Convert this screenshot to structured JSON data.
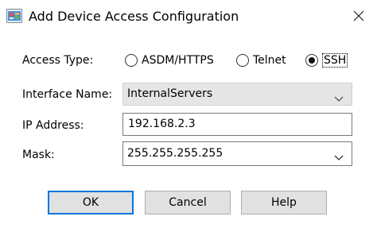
{
  "window": {
    "title": "Add Device Access Configuration",
    "app_icon": "asdm-app-icon",
    "close_icon": "close-icon"
  },
  "form": {
    "access_type": {
      "label": "Access Type:",
      "options": [
        {
          "label": "ASDM/HTTPS",
          "selected": false
        },
        {
          "label": "Telnet",
          "selected": false
        },
        {
          "label": "SSH",
          "selected": true
        }
      ]
    },
    "interface_name": {
      "label": "Interface Name:",
      "value": "InternalServers",
      "enabled": false
    },
    "ip_address": {
      "label": "IP Address:",
      "value": "192.168.2.3"
    },
    "mask": {
      "label": "Mask:",
      "value": "255.255.255.255"
    }
  },
  "buttons": {
    "ok": "OK",
    "cancel": "Cancel",
    "help": "Help"
  },
  "colors": {
    "default_button_border": "#0078d7",
    "disabled_field_bg": "#e5e5e5",
    "button_bg": "#e1e1e1"
  }
}
